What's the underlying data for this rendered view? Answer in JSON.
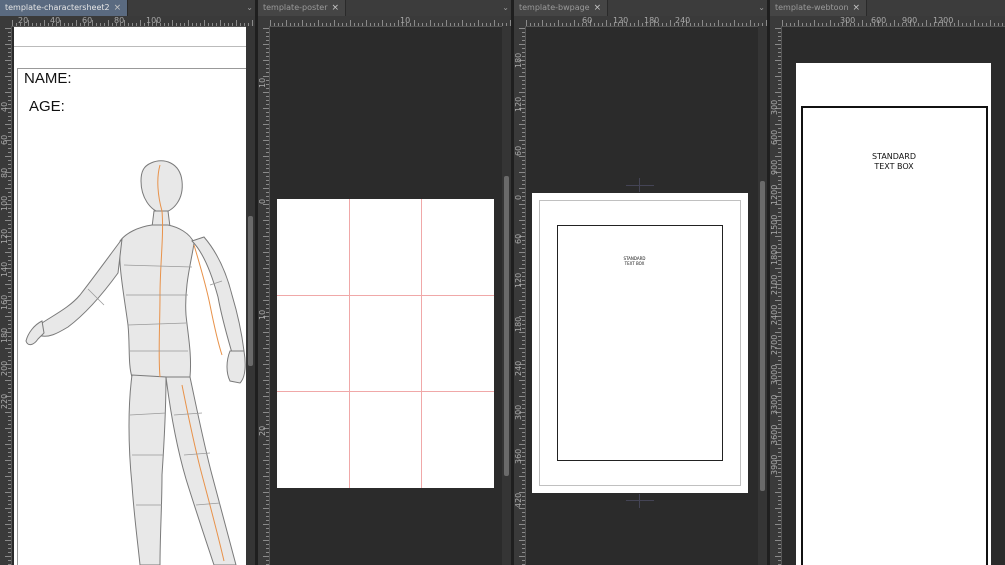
{
  "panes": [
    {
      "tab_title": "template-charactersheet2",
      "active": true,
      "ruler_h_labels": [
        "20",
        "40",
        "60",
        "80",
        "100"
      ],
      "ruler_v_labels": [
        "40",
        "60",
        "80",
        "100",
        "120",
        "140",
        "160",
        "180",
        "200",
        "220"
      ],
      "name_label": "NAME:",
      "age_label": "AGE:"
    },
    {
      "tab_title": "template-poster",
      "active": false,
      "ruler_h_labels": [
        "10"
      ],
      "ruler_v_labels": [
        "10",
        "0",
        "10",
        "20"
      ]
    },
    {
      "tab_title": "template-bwpage",
      "active": false,
      "ruler_h_labels": [
        "60",
        "120",
        "180",
        "240"
      ],
      "ruler_v_labels": [
        "180",
        "120",
        "60",
        "0",
        "60",
        "120",
        "180",
        "240",
        "300",
        "360",
        "420"
      ],
      "text_box_line1": "STANDARD",
      "text_box_line2": "TEXT BOX"
    },
    {
      "tab_title": "template-webtoon",
      "active": false,
      "ruler_h_labels": [
        "300",
        "600",
        "900",
        "1200"
      ],
      "ruler_v_labels": [
        "300",
        "600",
        "900",
        "1200",
        "1500",
        "1800",
        "2100",
        "2400",
        "2700",
        "3000",
        "3300",
        "3600",
        "3900"
      ],
      "text_box_line1": "STANDARD",
      "text_box_line2": "TEXT BOX"
    }
  ],
  "icons": {
    "close": "×",
    "tab_menu": "⌄"
  },
  "colors": {
    "active_tab": "#5a6a80",
    "guide_line": "#f0a8a8",
    "workspace": "#2b2b2b"
  }
}
